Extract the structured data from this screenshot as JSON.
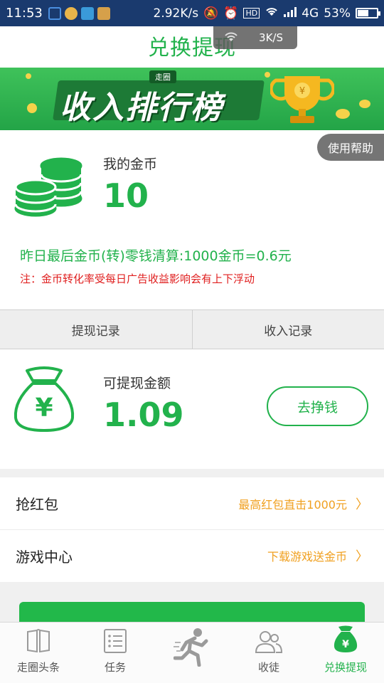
{
  "status_bar": {
    "time": "11:53",
    "net_speed": "2.92K/s",
    "network": "4G",
    "battery": "53%",
    "battery_level": 0.53
  },
  "header": {
    "title": "兑换提现",
    "speed_toast": "3K/S"
  },
  "banner": {
    "small_tag": "走圈",
    "text": "收入排行榜"
  },
  "coins": {
    "help_label": "使用帮助",
    "label": "我的金币",
    "value": "10",
    "rate_text": "昨日最后金币(转)零钱清算:1000金币=0.6元",
    "note_text": "注：金币转化率受每日广告收益影响会有上下浮动"
  },
  "tabs": [
    {
      "label": "提现记录"
    },
    {
      "label": "收入记录"
    }
  ],
  "withdraw": {
    "label": "可提现金额",
    "value": "1.09",
    "earn_button": "去挣钱"
  },
  "list": [
    {
      "title": "抢红包",
      "hint": "最高红包直击1000元"
    },
    {
      "title": "游戏中心",
      "hint": "下载游戏送金币"
    }
  ],
  "bottom_nav": [
    {
      "label": "走圈头条",
      "icon": "book-icon"
    },
    {
      "label": "任务",
      "icon": "list-icon"
    },
    {
      "label": "",
      "icon": "runner-icon"
    },
    {
      "label": "收徒",
      "icon": "people-icon"
    },
    {
      "label": "兑换提现",
      "icon": "money-bag-icon",
      "active": true
    }
  ],
  "colors": {
    "accent": "#22b24c",
    "warning": "#f0a020",
    "alert": "#e02020",
    "status_bar": "#1a3a6e"
  }
}
